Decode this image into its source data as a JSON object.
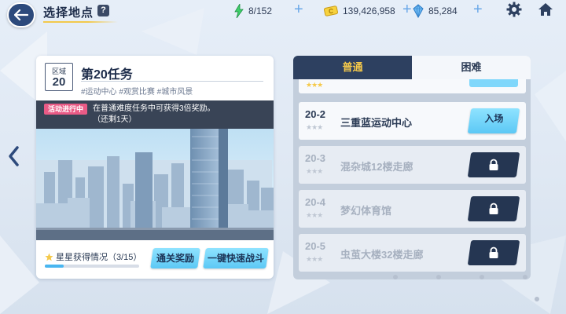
{
  "header": {
    "title": "选择地点",
    "help": "?",
    "stamina": "8/152",
    "gold": "139,426,958",
    "crystals": "85,284"
  },
  "mission": {
    "zone_label": "区域",
    "zone_number": "20",
    "title": "第20任务",
    "tags": "#运动中心 #观赏比赛 #城市风景",
    "event_badge": "活动进行中",
    "event_line1": "在普通难度任务中可获得3倍奖励。",
    "event_line2": "（还剩1天）",
    "stars_label": "星星获得情况（3/15）",
    "stars_progress": 0.2,
    "reward_button": "通关奖励",
    "quick_battle_button": "一键快速战斗"
  },
  "tabs": [
    {
      "label": "普通",
      "active": true
    },
    {
      "label": "困难",
      "active": false
    }
  ],
  "stages": [
    {
      "code": "20-2",
      "name": "三重蓝运动中心",
      "locked": false,
      "action": "入场"
    },
    {
      "code": "20-3",
      "name": "混杂城12楼走廊",
      "locked": true
    },
    {
      "code": "20-4",
      "name": "梦幻体育馆",
      "locked": true
    },
    {
      "code": "20-5",
      "name": "虫茧大楼32楼走廊",
      "locked": true
    }
  ],
  "icons": {
    "back": "back-arrow-icon",
    "stamina": "lightning-icon",
    "gold": "gold-ticket-icon",
    "crystal": "crystal-icon",
    "settings": "gear-icon",
    "home": "home-icon",
    "lock": "lock-icon",
    "star": "star-icon"
  },
  "colors": {
    "accent_blue": "#5cc8f5",
    "dark_navy": "#2d4060",
    "event_pink": "#ea5b86",
    "tab_gold": "#f5c94a"
  }
}
